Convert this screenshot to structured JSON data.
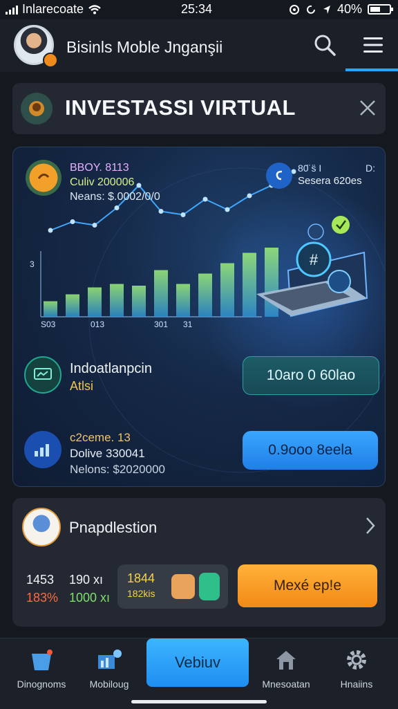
{
  "status_bar": {
    "carrier": "Inlarecoate",
    "time": "25:34",
    "battery": "40%"
  },
  "header": {
    "title": "Bisinls Moble Jnganşii"
  },
  "banner": {
    "title": "INVESTASSI VIRTUAL"
  },
  "card": {
    "top_left": {
      "line1": "BBOY. 8113",
      "line2": "Culiv 200006",
      "line3": "Neans: $.0002/0/0"
    },
    "top_right": {
      "line1": "80̈ s̈ I",
      "line1_right": "D:",
      "line2": "Sesera 620es"
    },
    "axis": {
      "y_tick": "3",
      "x_ticks": [
        "S03",
        "013",
        "301",
        "31"
      ]
    },
    "row1": {
      "title": "Indoatlanpcin",
      "subtitle": "Atlsi",
      "button": "10aro 0 60lao"
    },
    "row2": {
      "line1": "c2ceme. 13",
      "line2": "Dolive 330041",
      "line3": "Nelons: $2020000",
      "button": "0.9ooo 8eela"
    }
  },
  "chart_data": {
    "type": "bar",
    "values": [
      9,
      13,
      17,
      19,
      18,
      27,
      19,
      25,
      31,
      37,
      40
    ],
    "line": [
      18,
      23,
      21,
      31,
      44,
      29,
      27,
      36,
      30,
      38,
      44,
      52
    ],
    "ylim": [
      0,
      60
    ],
    "colors": {
      "bar_low": "#4ab5e8",
      "bar_high": "#b8f27a",
      "line": "#3fa7ff"
    }
  },
  "prediction": {
    "title": "Pnapdlestion",
    "stats": [
      {
        "a": "1453",
        "b": "190 xı",
        "a_color": "#f2f4f8",
        "b_color": "#f2f4f8"
      },
      {
        "a": "183%",
        "b": "1000 xı",
        "a_color": "#ff6a3d",
        "b_color": "#7ee06a"
      }
    ],
    "mini": {
      "top": "1844",
      "bottom": "182kis"
    },
    "button": "Mexé ep!e"
  },
  "nav": {
    "items": [
      {
        "label": "Dinognoms",
        "icon": "basket-icon"
      },
      {
        "label": "Mobiloug",
        "icon": "chart-gear-icon"
      },
      {
        "label": "Vebiuv",
        "icon": ""
      },
      {
        "label": "Mnesoatan",
        "icon": "home-icon"
      },
      {
        "label": "Hnaiins",
        "icon": "gear-icon"
      }
    ]
  },
  "colors": {
    "accent": "#2aa4f5",
    "orange": "#f28a16",
    "teal": "#1fa88f"
  }
}
